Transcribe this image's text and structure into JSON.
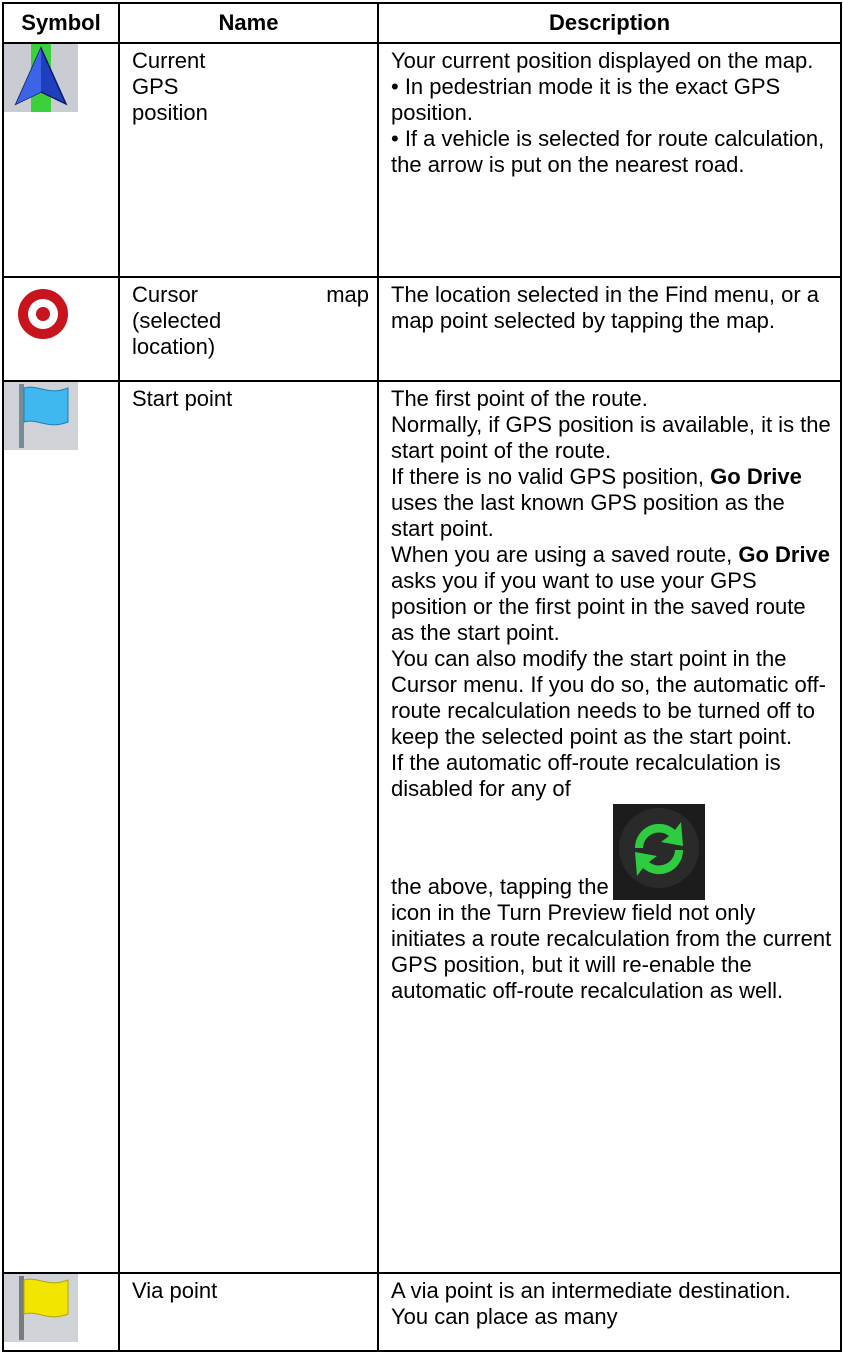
{
  "table": {
    "headers": [
      "Symbol",
      "Name",
      "Description"
    ],
    "rows": [
      {
        "icon": "current-position-arrow-icon",
        "name_lines": [
          "Current",
          "GPS",
          "position"
        ],
        "description": "Your current position displayed on the map.\n• In pedestrian mode it is the exact GPS position.\n• If a vehicle is selected for route calculation, the arrow is put on the nearest road."
      },
      {
        "icon": "cursor-target-icon",
        "name_left": "Cursor",
        "name_right": "map",
        "name_lines": [
          "(selected",
          "location)"
        ],
        "description": "The location selected in the Find menu, or a map point selected by tapping the map."
      },
      {
        "icon": "blue-flag-icon",
        "name": "Start point",
        "description_parts": {
          "p1": "The first point of the route.\nNormally, if GPS position is available, it is the start point of the route.\nIf there is no valid GPS position, ",
          "brand1": "Go Drive",
          "p2": " uses the last known GPS position as the start point.\nWhen you are using a saved route, ",
          "brand2": "Go Drive",
          "p3": " asks you if you want to use your GPS position or the first point in the saved route as the start point.\nYou can also modify the start point in the Cursor menu. If you do so, the automatic off-route recalculation needs to be turned off to keep the selected point as the start point.\nIf the automatic off-route recalculation is disabled for any of",
          "p4": "the above, tapping the",
          "p5": "icon in the Turn Preview field not only initiates a route recalculation from the current GPS position, but it will re-enable the automatic off-route recalculation as well."
        },
        "inline_icon": "recalculate-icon"
      },
      {
        "icon": "yellow-flag-icon",
        "name": "Via point",
        "description": "A via point is an intermediate destination. You can place as many"
      }
    ]
  },
  "colors": {
    "arrow_blue": "#1f3fbf",
    "road_green": "#3ad13a",
    "target_red": "#c8141c",
    "flag_blue": "#3fb8f0",
    "flag_yellow": "#f2e600",
    "recalc_green": "#2ecc40"
  }
}
